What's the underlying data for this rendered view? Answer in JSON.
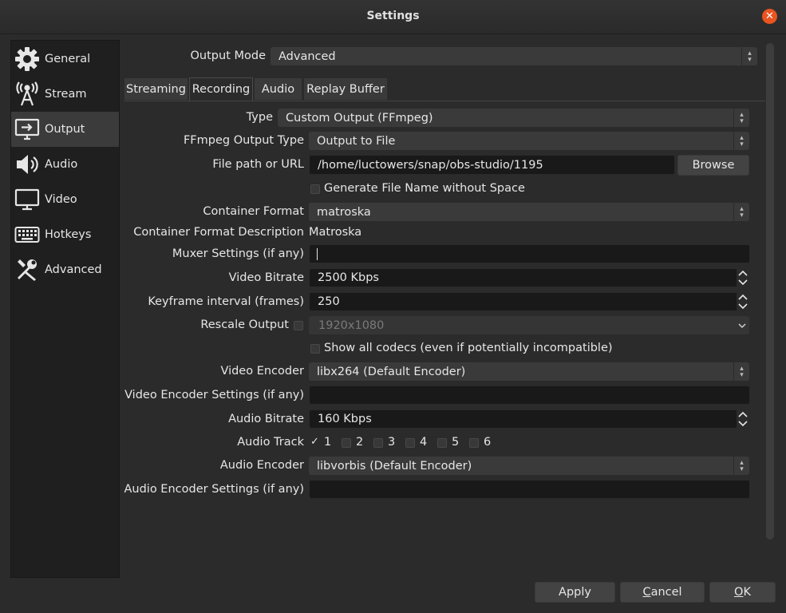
{
  "window": {
    "title": "Settings",
    "close_icon": "close-icon",
    "accent": "#e95420"
  },
  "sidebar": {
    "items": [
      {
        "label": "General",
        "icon": "gear-icon"
      },
      {
        "label": "Stream",
        "icon": "antenna-icon"
      },
      {
        "label": "Output",
        "icon": "output-icon"
      },
      {
        "label": "Audio",
        "icon": "speaker-icon"
      },
      {
        "label": "Video",
        "icon": "monitor-icon"
      },
      {
        "label": "Hotkeys",
        "icon": "keyboard-icon"
      },
      {
        "label": "Advanced",
        "icon": "tools-icon"
      }
    ],
    "active": "Output"
  },
  "output_mode": {
    "label": "Output Mode",
    "value": "Advanced"
  },
  "tabs": [
    "Streaming",
    "Recording",
    "Audio",
    "Replay Buffer"
  ],
  "active_tab": "Recording",
  "recording": {
    "type": {
      "label": "Type",
      "value": "Custom Output (FFmpeg)"
    },
    "ffmpeg_output_type": {
      "label": "FFmpeg Output Type",
      "value": "Output to File"
    },
    "file_path": {
      "label": "File path or URL",
      "value": "/home/luctowers/snap/obs-studio/1195",
      "browse": "Browse"
    },
    "generate_name": {
      "label": "Generate File Name without Space",
      "checked": false
    },
    "container_format": {
      "label": "Container Format",
      "value": "matroska"
    },
    "container_desc": {
      "label": "Container Format Description",
      "value": "Matroska"
    },
    "muxer_settings": {
      "label": "Muxer Settings (if any)",
      "value": ""
    },
    "video_bitrate": {
      "label": "Video Bitrate",
      "value": "2500 Kbps"
    },
    "keyframe_interval": {
      "label": "Keyframe interval (frames)",
      "value": "250"
    },
    "rescale_output": {
      "label": "Rescale Output",
      "checked": false,
      "value": "1920x1080"
    },
    "show_all_codecs": {
      "label": "Show all codecs (even if potentially incompatible)",
      "checked": false
    },
    "video_encoder": {
      "label": "Video Encoder",
      "value": "libx264 (Default Encoder)"
    },
    "video_encoder_settings": {
      "label": "Video Encoder Settings (if any)",
      "value": ""
    },
    "audio_bitrate": {
      "label": "Audio Bitrate",
      "value": "160 Kbps"
    },
    "audio_track": {
      "label": "Audio Track",
      "tracks": [
        "1",
        "2",
        "3",
        "4",
        "5",
        "6"
      ],
      "checked": [
        true,
        false,
        false,
        false,
        false,
        false
      ]
    },
    "audio_encoder": {
      "label": "Audio Encoder",
      "value": "libvorbis (Default Encoder)"
    },
    "audio_encoder_settings": {
      "label": "Audio Encoder Settings (if any)",
      "value": ""
    }
  },
  "buttons": {
    "apply": "Apply",
    "cancel": "Cancel",
    "cancel_mnemonic": "C",
    "cancel_rest": "ancel",
    "ok": "OK",
    "ok_mnemonic": "O",
    "ok_rest": "K"
  }
}
